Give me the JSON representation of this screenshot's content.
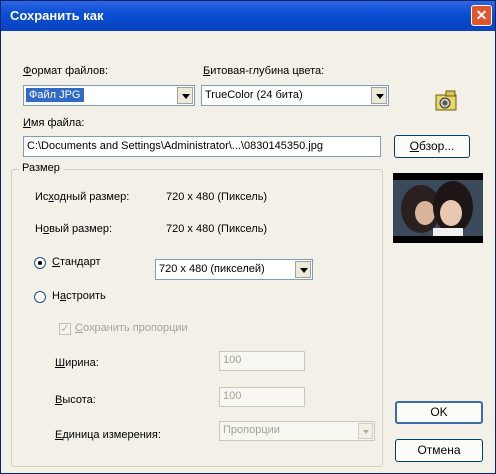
{
  "window": {
    "title": "Сохранить как",
    "close_glyph": "✕"
  },
  "format": {
    "label": "Формат файлов:",
    "value": "Файл JPG"
  },
  "bitdepth": {
    "label": "Битовая-глубина цвета:",
    "value": "TrueColor (24 бита)"
  },
  "filename": {
    "label": "Имя файла:",
    "value": "C:\\Documents and Settings\\Administrator\\...\\0830145350.jpg"
  },
  "browse_label": "Обзор...",
  "size_group": {
    "title": "Размер",
    "original_label": "Исходный размер:",
    "original_value": "720 x 480 (Пиксель)",
    "new_label": "Новый размер:",
    "new_value": "720 x 480 (Пиксель)"
  },
  "standard": {
    "label": "Стандарт",
    "value": "720 x 480 (пикселей)",
    "selected": true
  },
  "custom": {
    "label": "Настроить",
    "selected": false
  },
  "keep_proportions": {
    "label": "Сохранить пропорции",
    "checked": true
  },
  "width": {
    "label": "Ширина:",
    "value": "100"
  },
  "height": {
    "label": "Высота:",
    "value": "100"
  },
  "unit": {
    "label": "Единица измерения:",
    "value": "Пропорции"
  },
  "ok_label": "OK",
  "cancel_label": "Отмена",
  "icons": {
    "camera": "camera-icon",
    "thumbnail": "image-preview"
  }
}
